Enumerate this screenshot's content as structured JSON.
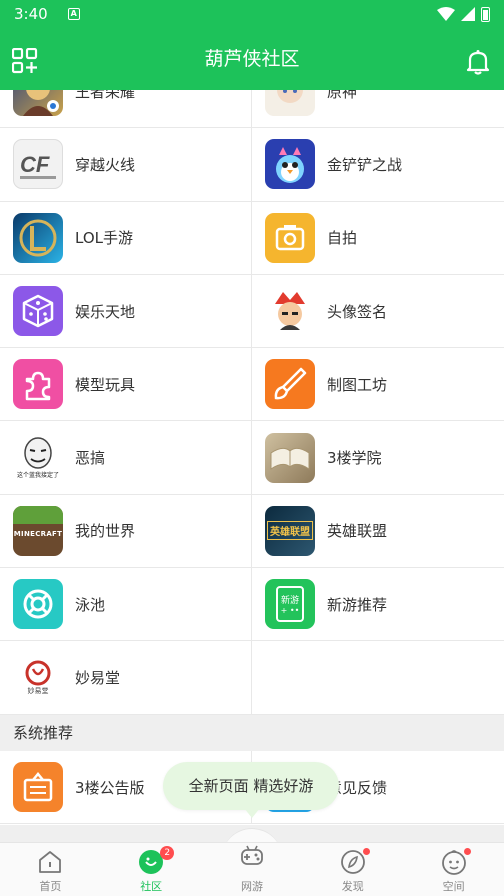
{
  "status_bar": {
    "time": "3:40",
    "sim_glyph": "A"
  },
  "app_bar": {
    "title": "葫芦侠社区"
  },
  "top_partial_row": [
    {
      "label": "王者荣耀"
    },
    {
      "label": "原神"
    }
  ],
  "categories": [
    [
      {
        "label": "穿越火线",
        "icon": "crossfire-icon"
      },
      {
        "label": "金铲铲之战",
        "icon": "penguin-icon"
      }
    ],
    [
      {
        "label": "LOL手游",
        "icon": "lol-icon"
      },
      {
        "label": "自拍",
        "icon": "camera-icon"
      }
    ],
    [
      {
        "label": "娱乐天地",
        "icon": "dice-icon"
      },
      {
        "label": "头像签名",
        "icon": "avatar-character-icon"
      }
    ],
    [
      {
        "label": "模型玩具",
        "icon": "puzzle-icon"
      },
      {
        "label": "制图工坊",
        "icon": "brush-icon"
      }
    ],
    [
      {
        "label": "恶搞",
        "icon": "meme-face-icon",
        "caption": "这个蓝我接定了"
      },
      {
        "label": "3楼学院",
        "icon": "book-icon"
      }
    ],
    [
      {
        "label": "我的世界",
        "icon": "minecraft-icon",
        "logo_text": "MINECRAFT"
      },
      {
        "label": "英雄联盟",
        "icon": "lol-pc-icon",
        "logo_text": "英雄联盟"
      }
    ],
    [
      {
        "label": "泳池",
        "icon": "lifebuoy-icon"
      },
      {
        "label": "新游推荐",
        "icon": "new-game-icon",
        "logo_text": "新游"
      }
    ],
    [
      {
        "label": "妙易堂",
        "icon": "miaoyitang-icon",
        "logo_text": "妙易堂"
      }
    ]
  ],
  "system_section": {
    "title": "系统推荐",
    "items": [
      {
        "label": "3楼公告版",
        "icon": "notice-board-icon"
      },
      {
        "label": "意见反馈",
        "icon": "feedback-icon"
      }
    ]
  },
  "toast": {
    "text": "全新页面  精选好游"
  },
  "tabs": [
    {
      "label": "首页",
      "icon": "home-icon"
    },
    {
      "label": "社区",
      "icon": "community-icon",
      "badge": "2",
      "active": true
    },
    {
      "label": "网游",
      "icon": "gamepad-icon"
    },
    {
      "label": "发现",
      "icon": "compass-icon"
    },
    {
      "label": "空间",
      "icon": "profile-icon"
    }
  ],
  "colors": {
    "brand_green": "#1dc25a",
    "badge_red": "#ff4d4f",
    "divider": "#e8e8e8"
  }
}
